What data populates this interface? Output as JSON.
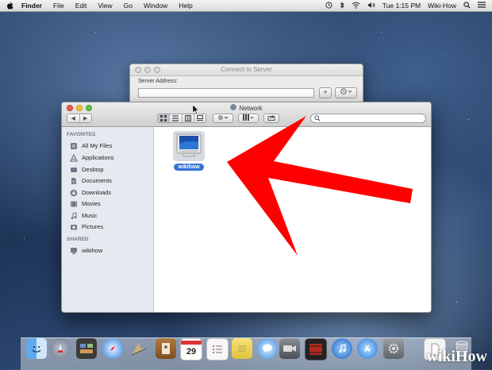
{
  "menubar": {
    "app": "Finder",
    "menus": [
      "File",
      "Edit",
      "View",
      "Go",
      "Window",
      "Help"
    ],
    "clock": "Tue 1:15 PM",
    "user": "Wiki-How"
  },
  "connect_dialog": {
    "title": "Connect to Server",
    "server_address_label": "Server Address:",
    "server_address_value": "",
    "add_button": "+"
  },
  "finder": {
    "title": "Network",
    "search_placeholder": "",
    "sidebar": {
      "favorites_header": "FAVORITES",
      "favorites": [
        {
          "label": "All My Files",
          "icon": "all-my-files-icon"
        },
        {
          "label": "Applications",
          "icon": "applications-icon"
        },
        {
          "label": "Desktop",
          "icon": "desktop-icon"
        },
        {
          "label": "Documents",
          "icon": "documents-icon"
        },
        {
          "label": "Downloads",
          "icon": "downloads-icon"
        },
        {
          "label": "Movies",
          "icon": "movies-icon"
        },
        {
          "label": "Music",
          "icon": "music-icon"
        },
        {
          "label": "Pictures",
          "icon": "pictures-icon"
        }
      ],
      "shared_header": "SHARED",
      "shared": [
        {
          "label": "wikihow",
          "icon": "shared-computer-icon"
        }
      ]
    },
    "items": [
      {
        "label": "wikihow",
        "icon": "computer-icon",
        "selected": true
      }
    ]
  },
  "dock": {
    "calendar_day": "29",
    "watermark": "wikiHow"
  },
  "colors": {
    "selection": "#3874d6",
    "arrow": "#ff0000",
    "sidebar_bg": "#e6eaf0"
  }
}
